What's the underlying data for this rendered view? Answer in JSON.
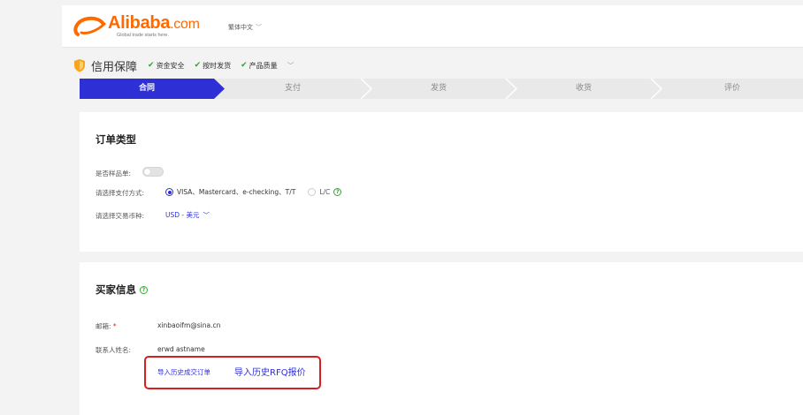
{
  "header": {
    "logo_main": "Alibaba",
    "logo_dotcom": ".com",
    "logo_tagline": "Global trade starts here.",
    "language": "繁体中文"
  },
  "credit": {
    "title": "信用保障",
    "tags": [
      "资金安全",
      "按时发货",
      "产品质量"
    ]
  },
  "steps": [
    "合同",
    "支付",
    "发货",
    "收货",
    "评价"
  ],
  "active_step": 0,
  "order_type": {
    "title": "订单类型",
    "sample_label": "是否样品单:",
    "sample_enabled": false,
    "payment_label": "请选择支付方式:",
    "payment_option_1": "VISA、Mastercard、e-checking、T/T",
    "payment_option_2": "L/C",
    "payment_selected": 1,
    "currency_label": "请选择交易币种:",
    "currency_value": "USD - 美元"
  },
  "buyer": {
    "title": "买家信息",
    "email_label": "邮箱:",
    "email_required_mark": "*",
    "email_value": "xinbaoifm@sina.cn",
    "name_label": "联系人姓名:",
    "name_value": "erwd astname",
    "import_order_link": "导入历史成交订单",
    "import_rfq_link": "导入历史RFQ报价"
  },
  "colors": {
    "accent_blue": "#2f2fd6",
    "brand_orange": "#ff6a00",
    "check_green": "#2ea82e",
    "highlight_red": "#d81e1e"
  }
}
